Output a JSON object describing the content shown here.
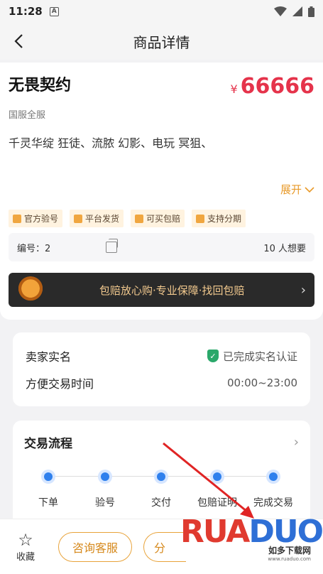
{
  "status_bar": {
    "time": "11:28",
    "notif_icon": "A"
  },
  "nav": {
    "title": "商品详情"
  },
  "product": {
    "title": "无畏契约",
    "currency": "¥",
    "price": "66666",
    "server": "国服全服",
    "description": "千灵华绽 狂徒、流脓 幻影、电玩 冥狙、",
    "expand_label": "展开"
  },
  "tags": [
    "官方验号",
    "平台发货",
    "可买包赔",
    "支持分期"
  ],
  "meta": {
    "id_text": "编号：2",
    "want_text": "10 人想要"
  },
  "banner": {
    "text": "包赔放心购·专业保障·找回包赔"
  },
  "seller": {
    "realname_label": "卖家实名",
    "realname_status": "已完成实名认证",
    "time_label": "方便交易时间",
    "time_value": "00:00~23:00"
  },
  "flow": {
    "title": "交易流程",
    "steps": [
      "下单",
      "验号",
      "交付",
      "包赔证明",
      "完成交易"
    ]
  },
  "bottom": {
    "fav_label": "收藏",
    "consult_label": "咨询客服",
    "second_label": "分"
  },
  "watermark": {
    "brand_a": "RUA",
    "brand_b": "DUO",
    "sub": "如多下载网",
    "url": "www.ruaduo.com"
  },
  "colors": {
    "price": "#e5334b",
    "accent": "#e8a33a",
    "step": "#2f80ed",
    "verified": "#2aa86a"
  }
}
